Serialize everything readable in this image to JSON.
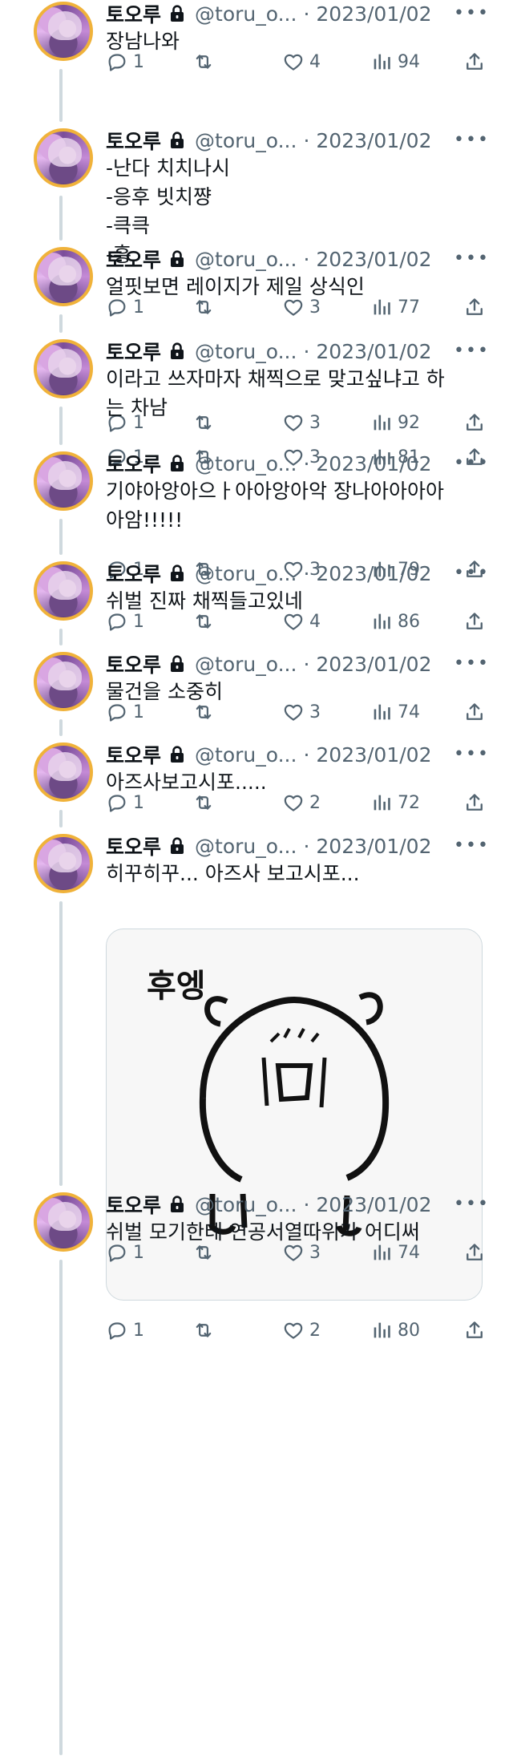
{
  "author": {
    "name": "토오루",
    "handle": "@toru_o...",
    "date": "2023/01/02",
    "separator": "·",
    "more": "•••"
  },
  "tweets": [
    {
      "lines": [
        "장남나와"
      ],
      "replies": "1",
      "retweets": "",
      "likes": "4",
      "views": "94"
    },
    {
      "lines": [
        "-난다 치치나시",
        "-응후 빗치쨩",
        "-큭큭",
        "-흥"
      ],
      "replies": "1",
      "retweets": "",
      "likes": "3",
      "views": "92"
    },
    {
      "lines": [
        "얼핏보면 레이지가 제일 상식인"
      ],
      "replies": "1",
      "retweets": "",
      "likes": "3",
      "views": "77"
    },
    {
      "lines": [
        "이라고 쓰자마자 채찍으로 맞고싶냐고 하",
        "는 차남"
      ],
      "replies": "1",
      "retweets": "",
      "likes": "3",
      "views": "81"
    },
    {
      "lines": [
        "기야아앙아으ㅏ아아앙아악 장나아아아아",
        "아암!!!!!"
      ],
      "replies": "1",
      "retweets": "",
      "likes": "3",
      "views": "79"
    },
    {
      "lines": [
        "쉬벌 진짜 채찍들고있네"
      ],
      "replies": "1",
      "retweets": "",
      "likes": "4",
      "views": "86"
    },
    {
      "lines": [
        "물건을 소중히"
      ],
      "replies": "1",
      "retweets": "",
      "likes": "3",
      "views": "74"
    },
    {
      "lines": [
        "아즈사보고시포....."
      ],
      "replies": "1",
      "retweets": "",
      "likes": "2",
      "views": "72"
    },
    {
      "lines": [
        "히꾸히꾸... 아즈사 보고시포..."
      ],
      "media_caption": "후엥",
      "replies": "1",
      "retweets": "",
      "likes": "2",
      "views": "80"
    },
    {
      "lines": [
        "쉬벌 모기한테 연공서열따위가 어디써"
      ],
      "replies": "1",
      "retweets": "",
      "likes": "3",
      "views": "74"
    }
  ],
  "colors": {
    "muted": "#536471",
    "thread": "#cfd9de",
    "text": "#0f1419"
  }
}
